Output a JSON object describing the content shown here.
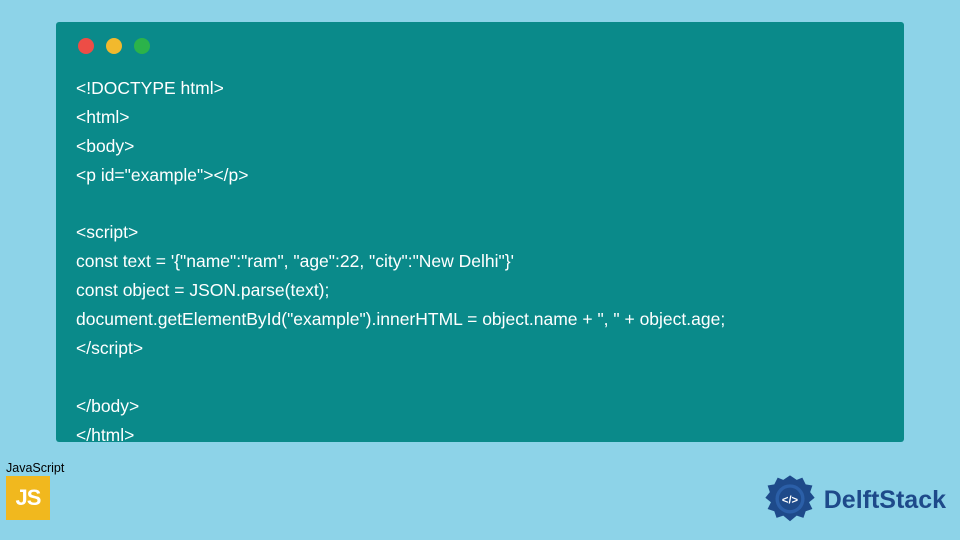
{
  "code": {
    "lines": [
      "<!DOCTYPE html>",
      "<html>",
      "<body>",
      "<p id=\"example\"></p>",
      "",
      "<script>",
      "const text = '{\"name\":\"ram\", \"age\":22, \"city\":\"New Delhi\"}'",
      "const object = JSON.parse(text);",
      "document.getElementById(\"example\").innerHTML = object.name + \", \" + object.age;",
      "</script>",
      "",
      "</body>",
      "</html>"
    ]
  },
  "badge": {
    "label": "JavaScript",
    "logo_text": "JS"
  },
  "brand": {
    "name": "DelftStack"
  },
  "colors": {
    "background": "#8dd3e8",
    "code_bg": "#0a8a8a",
    "code_text": "#ffffff",
    "js_logo": "#f1b81e",
    "brand_color": "#1e4a8a"
  }
}
